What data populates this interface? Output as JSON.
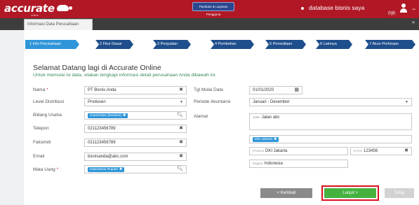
{
  "app": {
    "logo": "accurate",
    "logo_sub": "online",
    "banner": "Panduan & Layanan Pengguna",
    "database": "database bisnis saya",
    "database_sub": "(tgl)",
    "minimize": "−"
  },
  "tabs": {
    "active": "Informasi Data Perusahaan",
    "close": "✕"
  },
  "steps": [
    {
      "label": "1  Info Perusahaan"
    },
    {
      "label": "2  Fitur Dasar"
    },
    {
      "label": "3  Penjualan"
    },
    {
      "label": "4  Pembelian"
    },
    {
      "label": "5  Persediaan"
    },
    {
      "label": "6  Lainnya"
    },
    {
      "label": "7  Akun Perkiraan"
    }
  ],
  "form": {
    "title": "Selamat Datang lagi di Accurate Online",
    "intro": "Untuk memulai isi data, silakan lengkapi informasi detail perusahaan Anda dibawah ini.",
    "nama": {
      "label": "Nama",
      "required": "*",
      "value": "PT Bisnis Anda"
    },
    "level_distribusi": {
      "label": "Level Distribusi",
      "value": "Produsen"
    },
    "bidang_usaha": {
      "label": "Bidang Usaha",
      "chip": "Automotive (Dealers)"
    },
    "telepon": {
      "label": "Telepon",
      "value": "021123456789"
    },
    "faksimili": {
      "label": "Faksimili",
      "value": "021123456789"
    },
    "email": {
      "label": "Email",
      "value": "bisnisanda@abc.com"
    },
    "mata_uang": {
      "label": "Mata Uang",
      "required": "*",
      "chip": "Indonesian Rupiah"
    },
    "tgl_mulai_data": {
      "label": "Tgl Mulai Data",
      "value": "01/01/2020"
    },
    "periode_akuntansi": {
      "label": "Periode Akuntansi",
      "value": "Januari - Desember"
    },
    "alamat": {
      "label": "Alamat",
      "jalan_label": "Jalan",
      "jalan_value": "Jalan abc"
    },
    "kota": {
      "chip": "DKI Jakarta"
    },
    "provinsi": {
      "label": "Provinsi",
      "value": "DKI Jakarta"
    },
    "kode_pos": {
      "label": "K.Pos",
      "value": "123456"
    },
    "negara": {
      "label": "Negara",
      "value": "Indonesia"
    }
  },
  "buttons": {
    "back": "< Kembali",
    "next": "Lanjut >",
    "cancel": "Tutup"
  },
  "icons": {
    "field_clear": "clear-icon",
    "search": "search-icon",
    "calendar": "calendar-icon"
  },
  "colors": {
    "brand": "#b01826",
    "step": "#1f4e8c",
    "step_active": "#3096d9",
    "next": "#45b240",
    "highlight": "#d5121f"
  }
}
